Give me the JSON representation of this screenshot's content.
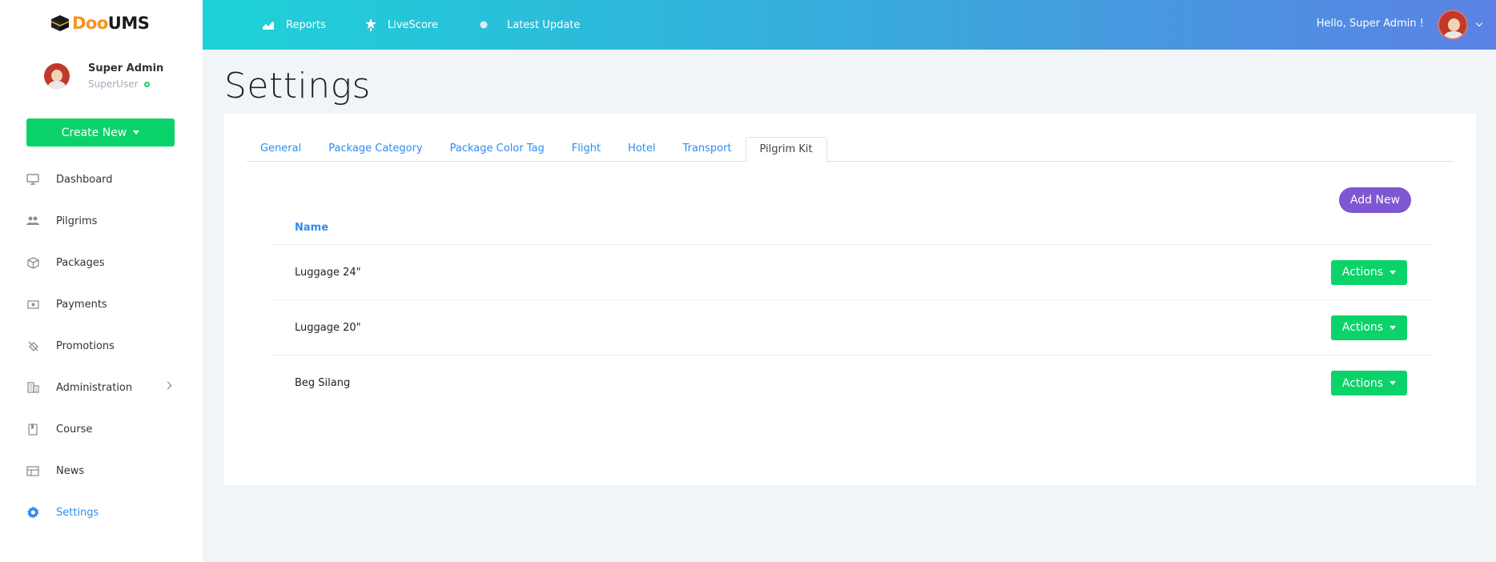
{
  "app": {
    "logo_doo": "Doo",
    "logo_ums": "UMS"
  },
  "profile": {
    "name": "Super Admin",
    "role": "SuperUser"
  },
  "create_button": "Create New",
  "sidebar": {
    "items": [
      {
        "label": "Dashboard",
        "icon": "monitor-icon"
      },
      {
        "label": "Pilgrims",
        "icon": "people-icon"
      },
      {
        "label": "Packages",
        "icon": "box-icon"
      },
      {
        "label": "Payments",
        "icon": "money-icon"
      },
      {
        "label": "Promotions",
        "icon": "tag-icon"
      },
      {
        "label": "Administration",
        "icon": "building-icon"
      },
      {
        "label": "Course",
        "icon": "book-icon"
      },
      {
        "label": "News",
        "icon": "newspaper-icon"
      },
      {
        "label": "Settings",
        "icon": "gear-icon"
      }
    ],
    "active": "Settings"
  },
  "header": {
    "links": [
      {
        "label": "Reports",
        "icon": "chart-icon"
      },
      {
        "label": "LiveScore",
        "icon": "star-icon"
      },
      {
        "label": "Latest Update",
        "icon": "dot-icon"
      }
    ],
    "greeting": "Hello, Super Admin !"
  },
  "page": {
    "title": "Settings"
  },
  "tabs": [
    {
      "label": "General"
    },
    {
      "label": "Package Category"
    },
    {
      "label": "Package Color Tag"
    },
    {
      "label": "Flight"
    },
    {
      "label": "Hotel"
    },
    {
      "label": "Transport"
    },
    {
      "label": "Pilgrim Kit"
    }
  ],
  "active_tab": "Pilgrim Kit",
  "add_new_label": "Add New",
  "table": {
    "header": "Name",
    "rows": [
      {
        "name": "Luggage 24\"",
        "action": "Actions"
      },
      {
        "name": "Luggage 20\"",
        "action": "Actions"
      },
      {
        "name": "Beg Silang",
        "action": "Actions"
      }
    ]
  },
  "colors": {
    "primary_green": "#0bd36a",
    "link_blue": "#2d8cf0",
    "purple": "#7e57d2",
    "header_gradient_start": "#1dd2d8",
    "header_gradient_end": "#5b82e4"
  }
}
